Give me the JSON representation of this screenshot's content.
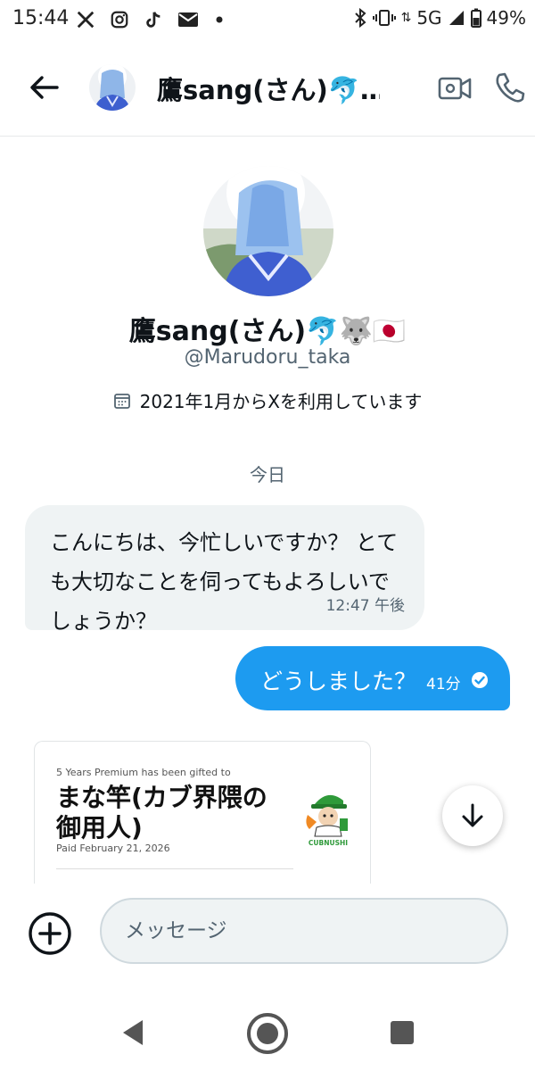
{
  "status_bar": {
    "time": "15:44",
    "network": "5G",
    "battery": "49%"
  },
  "header": {
    "title": "鷹sang(さん)🐬…",
    "icons": [
      "back-arrow-icon",
      "video-call-icon",
      "phone-icon"
    ]
  },
  "profile": {
    "name": "鷹sang(さん)🐬🐺🇯🇵",
    "handle": "@Marudoru_taka",
    "joined": "2021年1月からXを利用しています"
  },
  "conversation": {
    "date_label": "今日",
    "incoming": {
      "text": "こんにちは、今忙しいですか？ とても大切なことを伺ってもよろしいでしょうか？",
      "time": "12:47 午後"
    },
    "outgoing": {
      "text": "どうしました？",
      "time": "41分"
    },
    "card": {
      "header": "5 Years Premium has been gifted to",
      "title": "まな竿(カブ界隈の御用人)",
      "paid": "Paid February 21, 2026",
      "logo_text": "CUBNUSHI"
    }
  },
  "composer": {
    "placeholder": "メッセージ"
  },
  "colors": {
    "accent": "#1d9bf0",
    "incoming_bubble": "#eff3f4",
    "text_primary": "#0f1419",
    "text_secondary": "#536471"
  }
}
